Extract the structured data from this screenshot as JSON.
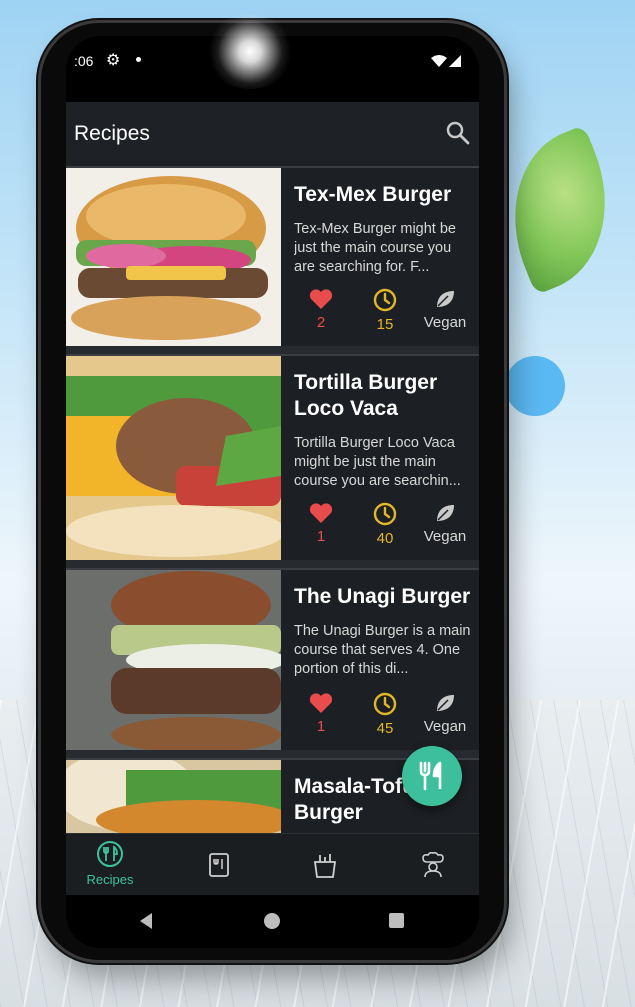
{
  "status_bar": {
    "time": ":06"
  },
  "app_bar": {
    "title": "Recipes"
  },
  "recipes": [
    {
      "name": "Tex-Mex Burger",
      "description": "Tex-Mex Burger might be just the main course you are searching for. F...",
      "likes": "2",
      "minutes": "15",
      "diet": "Vegan"
    },
    {
      "name": "Tortilla Burger Loco Vaca",
      "description": "Tortilla Burger Loco Vaca might be just the main course you are searchin...",
      "likes": "1",
      "minutes": "40",
      "diet": "Vegan"
    },
    {
      "name": "The Unagi Burger",
      "description": "The Unagi Burger is a main course that serves 4. One portion of this di...",
      "likes": "1",
      "minutes": "45",
      "diet": "Vegan"
    },
    {
      "name": "Masala-Tofu Burger",
      "description": "",
      "likes": "",
      "minutes": "",
      "diet": ""
    }
  ],
  "bottom_nav": {
    "items": [
      {
        "label": "Recipes",
        "icon": "recipes-icon",
        "active": true
      },
      {
        "label": "",
        "icon": "favorites-icon",
        "active": false
      },
      {
        "label": "",
        "icon": "food-joke-icon",
        "active": false
      },
      {
        "label": "",
        "icon": "chef-icon",
        "active": false
      }
    ]
  },
  "colors": {
    "accent": "#3cbf9a",
    "like": "#e84c4c",
    "time": "#e3b72a",
    "card_bg": "#1c1f23"
  }
}
